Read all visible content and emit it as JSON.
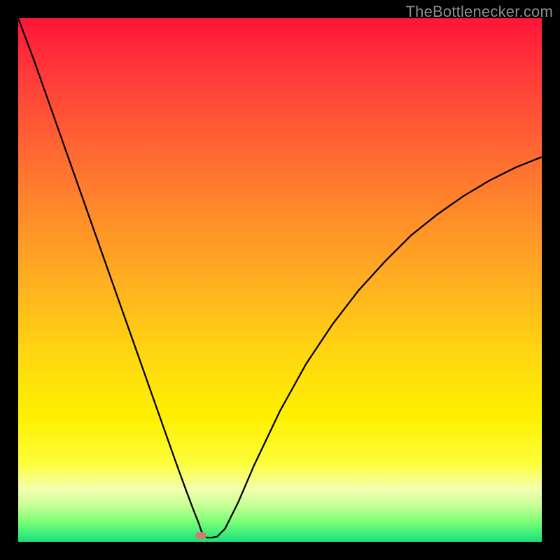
{
  "watermark": "TheBottlenecker.com",
  "chart_data": {
    "type": "line",
    "title": "",
    "xlabel": "",
    "ylabel": "",
    "xlim": [
      0,
      100
    ],
    "ylim": [
      0,
      100
    ],
    "legend": false,
    "grid": false,
    "series": [
      {
        "name": "curve",
        "x": [
          0,
          3,
          6,
          9,
          12,
          15,
          18,
          21,
          24,
          27,
          30,
          32,
          33.5,
          34.5,
          35,
          35.5,
          36,
          36.5,
          37,
          38,
          39.5,
          42,
          45,
          50,
          55,
          60,
          65,
          70,
          75,
          80,
          85,
          90,
          95,
          100
        ],
        "y": [
          100,
          92,
          83.5,
          75,
          66.5,
          58,
          49.5,
          41,
          32.5,
          24,
          15.5,
          10,
          6,
          3.5,
          2,
          1.2,
          0.8,
          0.8,
          0.8,
          1.0,
          2.5,
          7.5,
          14.5,
          25,
          34,
          41.5,
          48,
          53.5,
          58.5,
          62.5,
          66,
          69,
          71.5,
          73.5
        ]
      }
    ],
    "marker": {
      "x": 35,
      "y": 1.2
    },
    "background": {
      "type": "vertical-gradient",
      "stops": [
        {
          "pos": 0.0,
          "color": "#ff1637"
        },
        {
          "pos": 0.5,
          "color": "#ffb41f"
        },
        {
          "pos": 0.8,
          "color": "#fff000"
        },
        {
          "pos": 1.0,
          "color": "#16e27d"
        }
      ]
    }
  }
}
